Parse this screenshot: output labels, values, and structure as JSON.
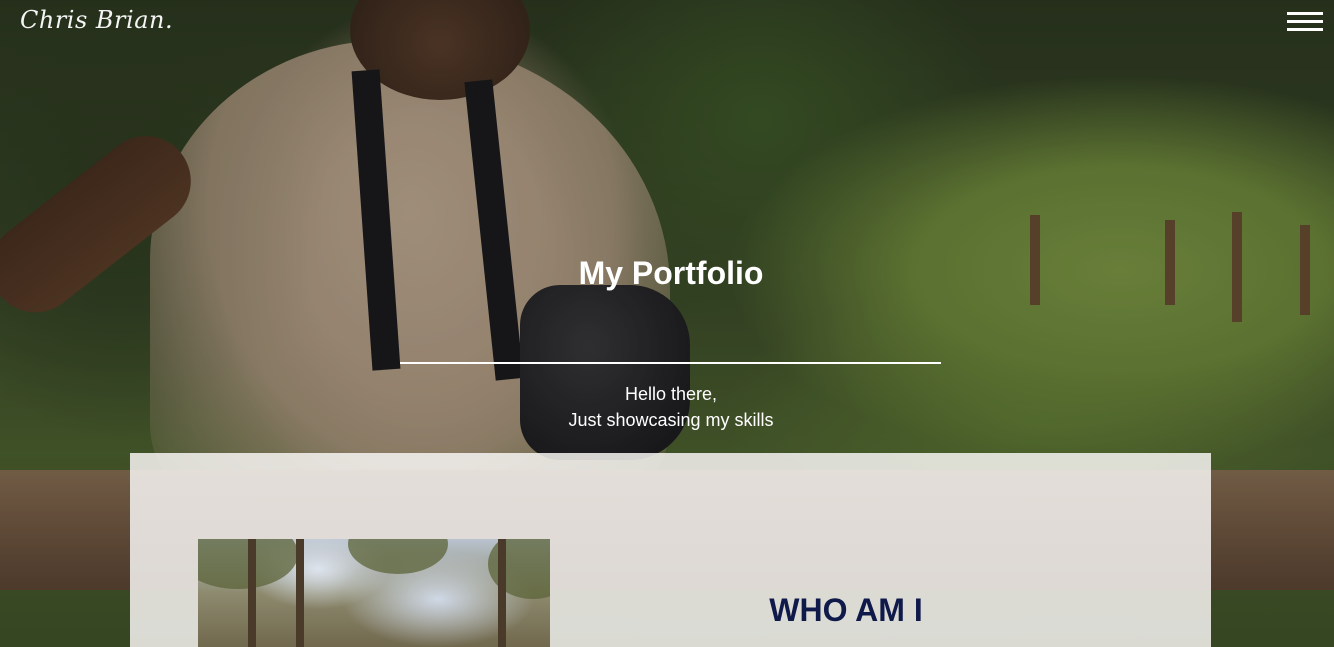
{
  "header": {
    "logo_text": "Chris Brian.",
    "menu_icon": "hamburger-menu-icon"
  },
  "hero": {
    "title": "My Portfolio",
    "greeting": "Hello there,",
    "tagline": "Just showcasing my skills"
  },
  "about": {
    "heading": "WHO AM I"
  },
  "colors": {
    "hero_text": "#ffffff",
    "about_heading": "#0f1a4a",
    "card_background": "#f6f3f1"
  }
}
